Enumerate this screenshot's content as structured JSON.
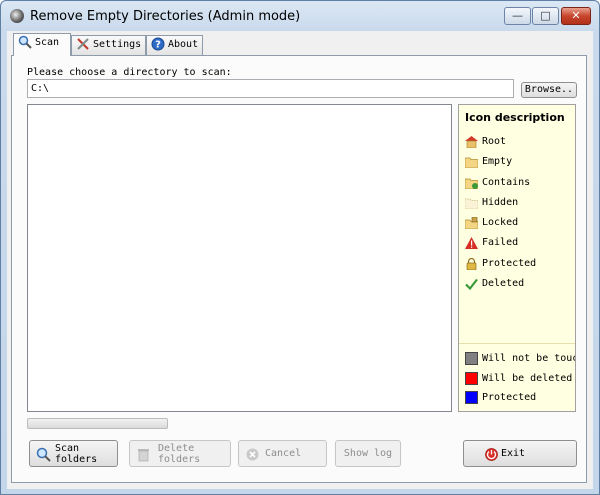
{
  "window": {
    "title": "Remove Empty Directories (Admin mode)"
  },
  "tabs": [
    {
      "label": "Scan",
      "icon": "magnifier-icon",
      "active": true
    },
    {
      "label": "Settings",
      "icon": "tools-icon",
      "active": false
    },
    {
      "label": "About",
      "icon": "help-icon",
      "active": false
    }
  ],
  "scan": {
    "prompt": "Please choose a directory to scan:",
    "path": "C:\\",
    "browse_label": "Browse.."
  },
  "legend": {
    "title": "Icon description",
    "items": [
      {
        "label": "Root",
        "icon": "root-folder-icon"
      },
      {
        "label": "Empty",
        "icon": "empty-folder-icon"
      },
      {
        "label": "Contains",
        "icon": "contains-folder-icon"
      },
      {
        "label": "Hidden",
        "icon": "hidden-folder-icon"
      },
      {
        "label": "Locked",
        "icon": "locked-folder-icon"
      },
      {
        "label": "Failed",
        "icon": "failed-warning-icon"
      },
      {
        "label": "Protected",
        "icon": "protected-lock-icon"
      },
      {
        "label": "Deleted",
        "icon": "deleted-check-icon"
      }
    ],
    "colors": [
      {
        "label": "Will not be touched",
        "color": "#808080"
      },
      {
        "label": "Will be deleted",
        "color": "#ff0000"
      },
      {
        "label": "Protected",
        "color": "#0000ff"
      }
    ]
  },
  "progress": {
    "value": 0
  },
  "buttons": {
    "scan_line1": "Scan",
    "scan_line2": "folders",
    "delete_line1": "Delete",
    "delete_line2": "folders",
    "cancel": "Cancel",
    "show_log": "Show log",
    "exit": "Exit"
  }
}
